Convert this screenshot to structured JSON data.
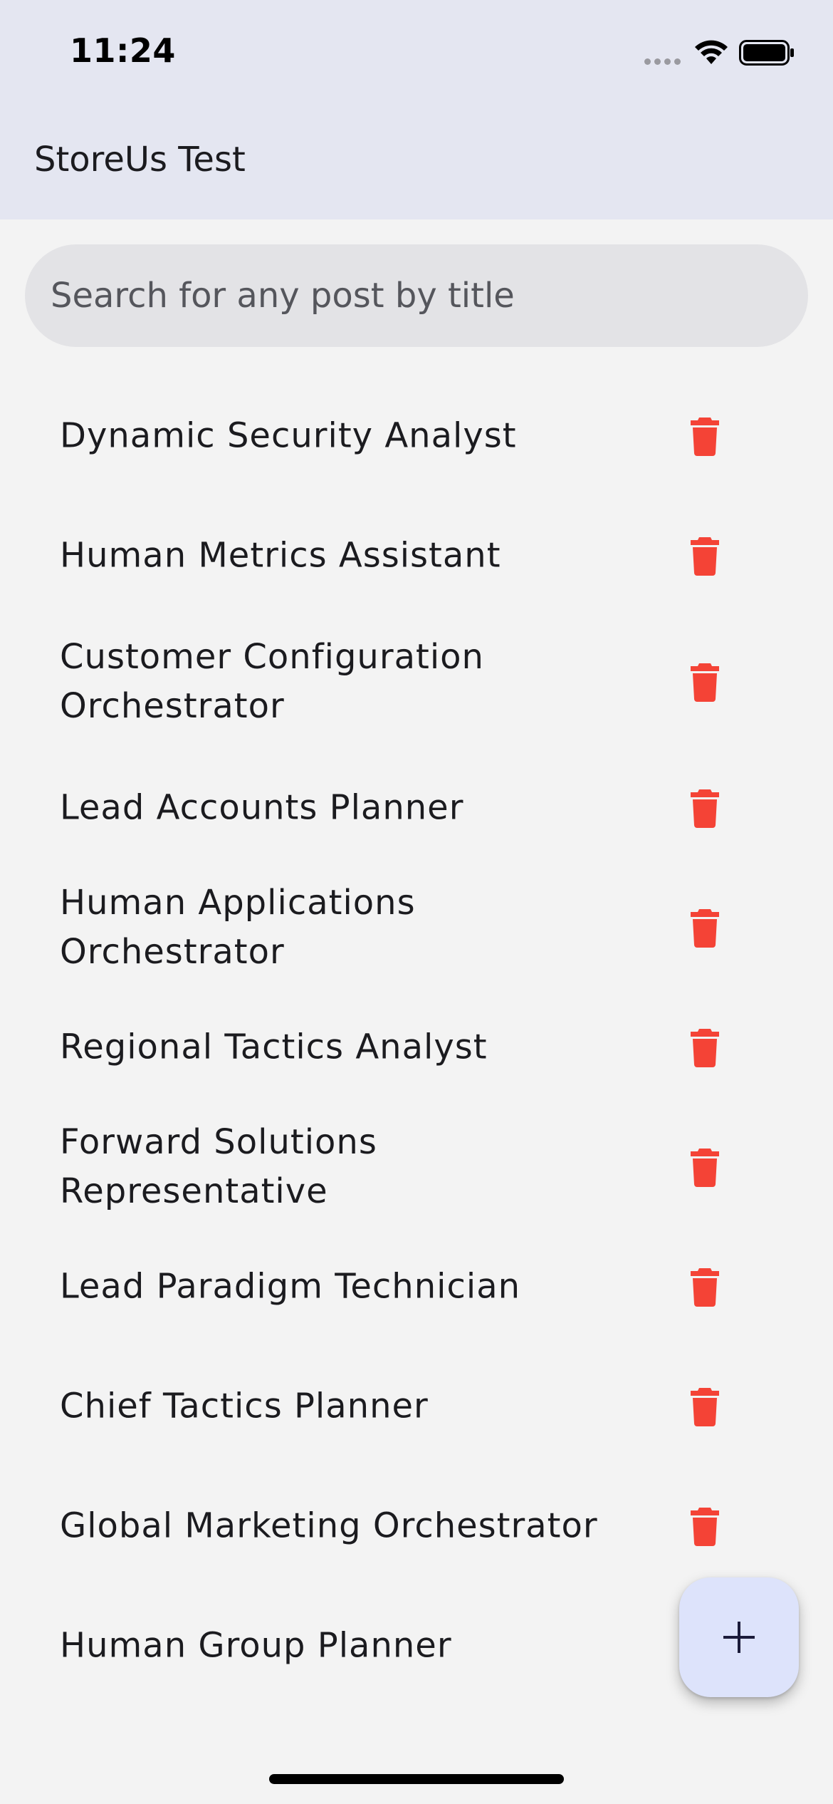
{
  "status_bar": {
    "time": "11:24",
    "icons": [
      "cellular-signal-icon",
      "wifi-icon",
      "battery-icon"
    ]
  },
  "app_bar": {
    "title": "StoreUs Test"
  },
  "search": {
    "placeholder": "Search for any post by title",
    "value": ""
  },
  "posts": [
    {
      "title": "Dynamic Security Analyst"
    },
    {
      "title": "Human Metrics Assistant"
    },
    {
      "title": "Customer Configuration Orchestrator"
    },
    {
      "title": "Lead Accounts Planner"
    },
    {
      "title": "Human Applications Orchestrator"
    },
    {
      "title": "Regional Tactics Analyst"
    },
    {
      "title": "Forward Solutions Representative"
    },
    {
      "title": "Lead Paradigm Technician"
    },
    {
      "title": "Chief Tactics Planner"
    },
    {
      "title": "Global Marketing Orchestrator"
    },
    {
      "title": "Human Group Planner"
    }
  ],
  "icons": {
    "delete": "trash-icon",
    "add": "plus-icon"
  },
  "colors": {
    "header_background": "#e4e6f1",
    "page_background": "#f3f3f3",
    "delete_icon": "#f44336",
    "fab_background": "#dde3fb",
    "fab_icon": "#1b1b3a"
  }
}
